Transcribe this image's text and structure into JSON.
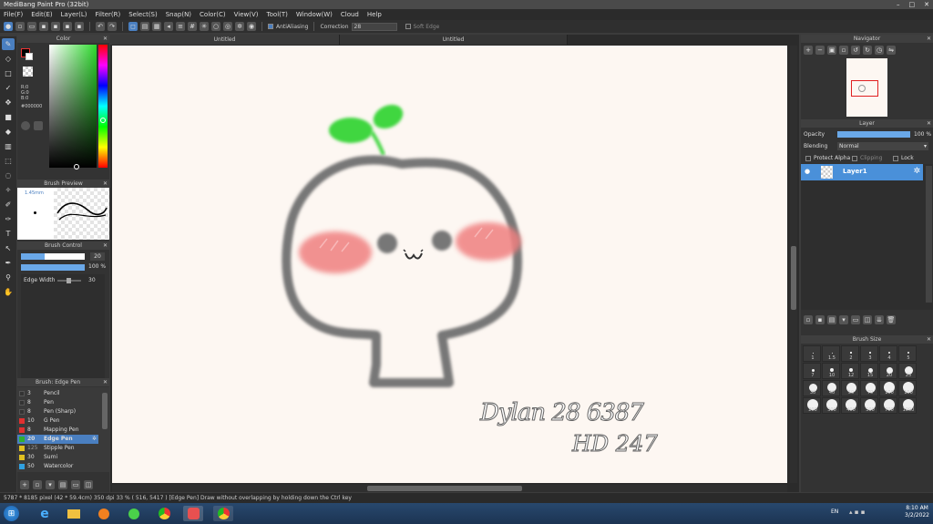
{
  "window": {
    "title": "MediBang Paint Pro (32bit)"
  },
  "menu": [
    "File(F)",
    "Edit(E)",
    "Layer(L)",
    "Filter(R)",
    "Select(S)",
    "Snap(N)",
    "Color(C)",
    "View(V)",
    "Tool(T)",
    "Window(W)",
    "Cloud",
    "Help"
  ],
  "toolbar": {
    "antialiasing_label": "AntiAliasing",
    "correction_label": "Correction",
    "correction_value": "28",
    "soft_edge_label": "Soft Edge"
  },
  "panels": {
    "color": {
      "title": "Color",
      "r": "R:0",
      "g": "G:0",
      "b": "B:0",
      "hex": "#000000"
    },
    "brush_preview": {
      "title": "Brush Preview",
      "size": "1.45mm"
    },
    "brush_control": {
      "title": "Brush Control",
      "size_value": "20",
      "opacity_value": "100 %",
      "edge_width_label": "Edge Width",
      "edge_width_value": "30"
    },
    "brush_list": {
      "title": "Brush: Edge Pen",
      "items": [
        {
          "size": "3",
          "name": "Pencil",
          "color": "#333333"
        },
        {
          "size": "8",
          "name": "Pen",
          "color": "#333333"
        },
        {
          "size": "8",
          "name": "Pen (Sharp)",
          "color": "#333333"
        },
        {
          "size": "10",
          "name": "G Pen",
          "color": "#e03030"
        },
        {
          "size": "8",
          "name": "Mapping Pen",
          "color": "#e03030"
        },
        {
          "size": "20",
          "name": "Edge Pen",
          "color": "#30b030"
        },
        {
          "size": "125",
          "name": "Stipple Pen",
          "color": "#e0c020"
        },
        {
          "size": "30",
          "name": "Sumi",
          "color": "#e0c020"
        },
        {
          "size": "50",
          "name": "Watercolor",
          "color": "#30a0e0"
        }
      ]
    },
    "navigator": {
      "title": "Navigator"
    },
    "layer": {
      "title": "Layer",
      "opacity_label": "Opacity",
      "opacity_value": "100 %",
      "blending_label": "Blending",
      "blending_value": "Normal",
      "protect_alpha_label": "Protect Alpha",
      "clipping_label": "Clipping",
      "lock_label": "Lock",
      "layer_name": "Layer1"
    },
    "brush_size": {
      "title": "Brush Size",
      "sizes": [
        "1",
        "1.5",
        "2",
        "3",
        "4",
        "5",
        "7",
        "10",
        "12",
        "15",
        "20",
        "25",
        "30",
        "40",
        "50",
        "70",
        "100",
        "150",
        "200",
        "300",
        "400",
        "500",
        "700",
        "1000"
      ]
    }
  },
  "document": {
    "tab1": "Untitled",
    "tab2": "Untitled",
    "signature_line1": "Dylan 28 6387",
    "signature_line2": "HD 247"
  },
  "statusbar": {
    "text": "5787 * 8185 pixel   (42 * 59.4cm)   350 dpi   33 %   ( 516, 5417 )   [Edge Pen] Draw without overlapping by holding down the Ctrl key"
  },
  "taskbar": {
    "lang": "EN",
    "time": "8:10 AM",
    "date": "3/2/2022"
  },
  "colors": {
    "accent": "#4a7fc0",
    "sprout": "#3fd63f",
    "blush": "#f08080",
    "stroke": "#777777"
  }
}
